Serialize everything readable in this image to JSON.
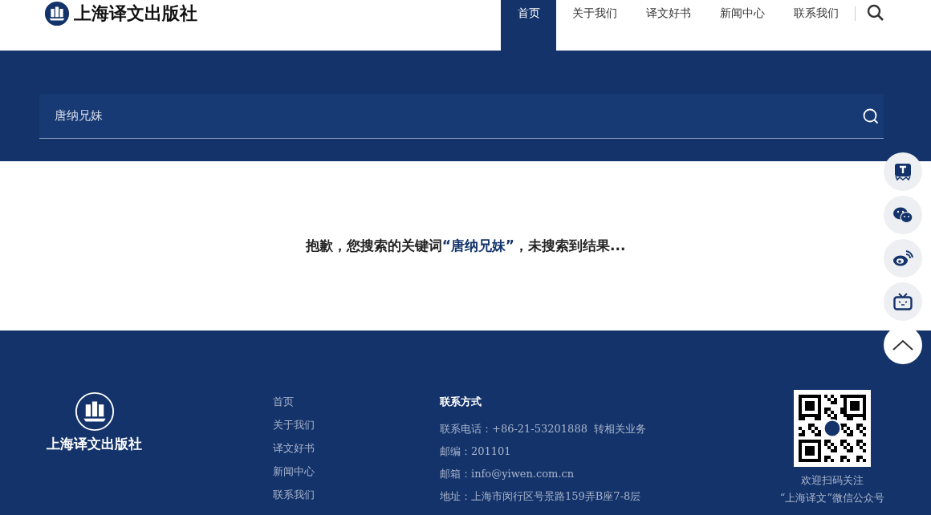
{
  "header": {
    "logo_text": "上海译文出版社",
    "nav": [
      {
        "label": "首页",
        "selected": true
      },
      {
        "label": "关于我们",
        "selected": false
      },
      {
        "label": "译文好书",
        "selected": false
      },
      {
        "label": "新闻中心",
        "selected": false
      },
      {
        "label": "联系我们",
        "selected": false
      }
    ]
  },
  "search": {
    "value": "唐纳兄妹"
  },
  "message": {
    "prefix": "抱歉，您搜索的关键词",
    "keyword": "“唐纳兄妹”",
    "suffix": "，未搜索到结果..."
  },
  "side_buttons": [
    {
      "kind": "t"
    },
    {
      "kind": "wechat"
    },
    {
      "kind": "weibo"
    },
    {
      "kind": "tv"
    },
    {
      "kind": "top"
    }
  ],
  "footer": {
    "logo_text": "上海译文出版社",
    "links": [
      "首页",
      "关于我们",
      "译文好书",
      "新闻中心",
      "联系我们"
    ],
    "contact_title": "联系方式",
    "contact": [
      "联系电话：+86-21-53201888  转相关业务",
      "邮编：201101",
      "邮箱：info@yiwen.com.cn",
      "地址：上海市闵行区号景路159弄B座7-8层"
    ],
    "qr_caption": [
      "欢迎扫码关注",
      "“上海译文”微信公众号"
    ]
  }
}
